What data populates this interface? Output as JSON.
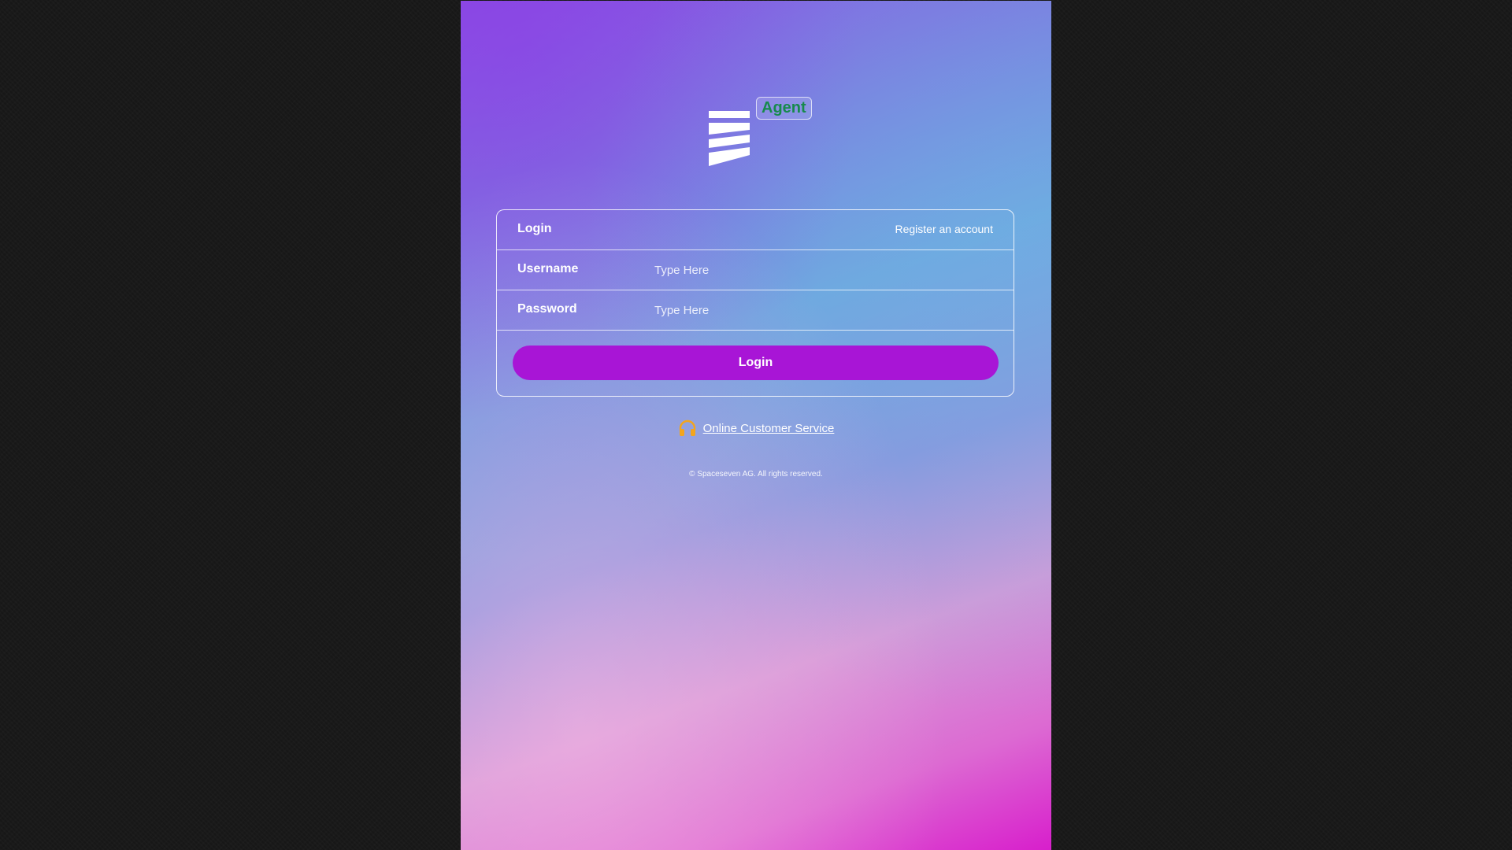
{
  "brand": {
    "badge": "Agent",
    "logo_icon": "spaceseven-logo-icon"
  },
  "login_card": {
    "title": "Login",
    "register_link": "Register an account",
    "username": {
      "label": "Username",
      "value": "",
      "placeholder": "Type Here"
    },
    "password": {
      "label": "Password",
      "value": "",
      "placeholder": "Type Here"
    },
    "submit_label": "Login"
  },
  "support": {
    "icon": "headset-icon",
    "link_text": "Online Customer Service"
  },
  "footer": {
    "copyright": "© Spaceseven AG. All rights reserved."
  },
  "colors": {
    "button": "#a815d6",
    "badge_text": "#178a4c",
    "headset": "#f3a51d",
    "outer_background": "#171717"
  }
}
